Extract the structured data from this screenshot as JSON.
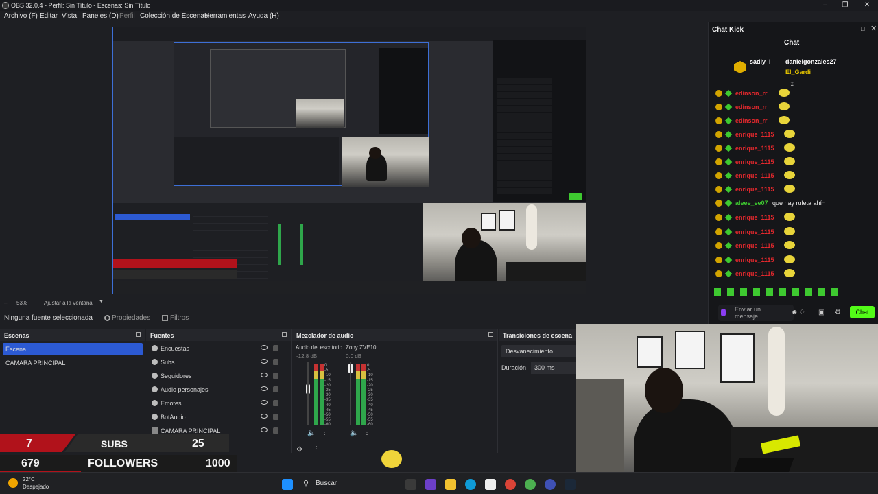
{
  "window": {
    "title": "OBS 32.0.4 - Perfil: Sin Título - Escenas: Sin Título"
  },
  "menu": [
    {
      "label": "Archivo (F)"
    },
    {
      "label": "Editar"
    },
    {
      "label": "Vista"
    },
    {
      "label": "Paneles (D)"
    },
    {
      "label": "Perfil"
    },
    {
      "label": "Colección de Escenas"
    },
    {
      "label": "Herramientas"
    },
    {
      "label": "Ayuda (H)"
    }
  ],
  "zoom": {
    "percent": "53%",
    "fit_label": "Ajustar a la ventana"
  },
  "context_bar": {
    "no_source": "Ninguna fuente seleccionada",
    "properties": "Propiedades",
    "filters": "Filtros"
  },
  "scenes": {
    "title": "Escenas",
    "items": [
      {
        "label": "Escena"
      },
      {
        "label": "CAMARA PRINCIPAL"
      }
    ]
  },
  "sources": {
    "title": "Fuentes",
    "items": [
      {
        "label": "Encuestas"
      },
      {
        "label": "Subs"
      },
      {
        "label": "Seguidores"
      },
      {
        "label": "Audio personajes"
      },
      {
        "label": "Emotes"
      },
      {
        "label": "BotAudio"
      },
      {
        "label": "CAMARA PRINCIPAL"
      }
    ]
  },
  "mixer": {
    "title": "Mezclador de audio",
    "channels": [
      {
        "name": "Audio del escritorio",
        "db": "-12.8 dB"
      },
      {
        "name": "Zony ZVE10",
        "db": "0.0 dB"
      }
    ],
    "scale": [
      "0",
      "-5",
      "-10",
      "-15",
      "-20",
      "-25",
      "-30",
      "-35",
      "-40",
      "-45",
      "-50",
      "-55",
      "-60"
    ]
  },
  "transitions": {
    "title": "Transiciones de escena",
    "selected": "Desvanecimiento",
    "duration_label": "Duración",
    "duration_value": "300 ms"
  },
  "overlay": {
    "subs_count": "7",
    "subs_label": "SUBS",
    "subs_goal": "25",
    "followers_count": "679",
    "followers_label": "FOLLOWERS",
    "followers_goal": "1000"
  },
  "chat": {
    "window_title": "Chat Kick",
    "header": "Chat",
    "pinned": [
      {
        "user": "sadly_i"
      },
      {
        "user": "danielgonzales27"
      },
      {
        "user": "El_Gardi"
      }
    ],
    "messages": [
      {
        "user": "edinson_rr",
        "text": ""
      },
      {
        "user": "edinson_rr",
        "text": ""
      },
      {
        "user": "edinson_rr",
        "text": ""
      },
      {
        "user": "enrique_1115",
        "text": ""
      },
      {
        "user": "enrique_1115",
        "text": ""
      },
      {
        "user": "enrique_1115",
        "text": ""
      },
      {
        "user": "enrique_1115",
        "text": ""
      },
      {
        "user": "enrique_1115",
        "text": ""
      },
      {
        "user": "aleee_ee07",
        "text": "que hay ruleta ahí="
      },
      {
        "user": "enrique_1115",
        "text": ""
      },
      {
        "user": "enrique_1115",
        "text": ""
      },
      {
        "user": "enrique_1115",
        "text": ""
      },
      {
        "user": "enrique_1115",
        "text": ""
      },
      {
        "user": "enrique_1115",
        "text": ""
      }
    ],
    "input_placeholder": "Enviar un mensaje",
    "send_label": "Chat"
  },
  "taskbar": {
    "temperature": "22°C",
    "weather": "Despejado",
    "search": "Buscar"
  },
  "colors": {
    "accent": "#2c5ad3",
    "kick_green": "#53fc18",
    "alert_red": "#b1121b"
  }
}
